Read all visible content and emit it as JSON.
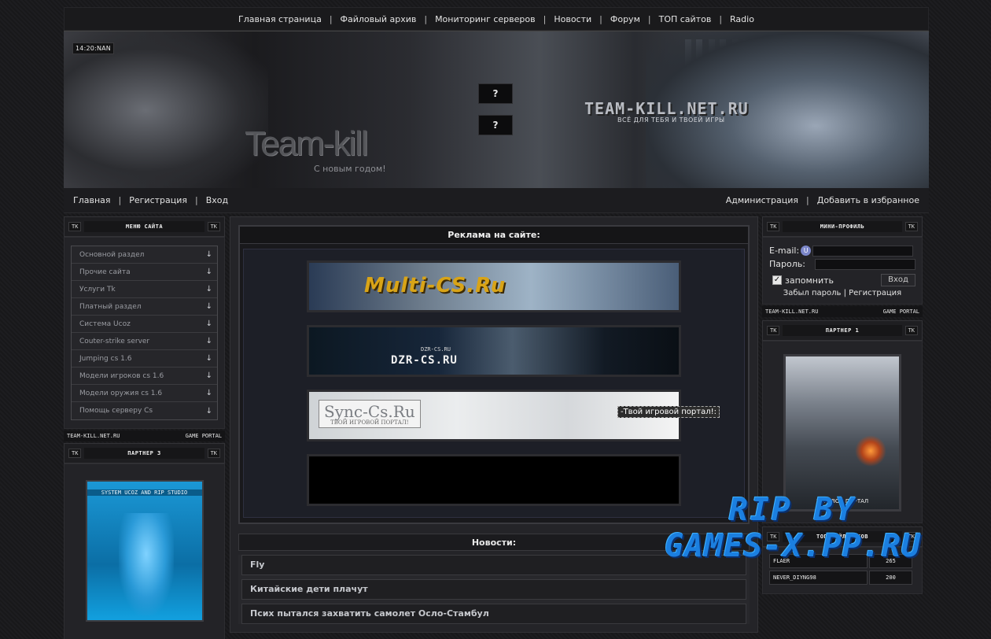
{
  "top_nav": [
    {
      "label": "Главная страница"
    },
    {
      "label": "Файловый архив"
    },
    {
      "label": "Мониторинг серверов"
    },
    {
      "label": "Новости"
    },
    {
      "label": "Форум"
    },
    {
      "label": "ТОП сайтов"
    },
    {
      "label": "Radio"
    }
  ],
  "banner": {
    "clock": "14:20:NAN",
    "buttons": [
      "?",
      "?"
    ],
    "logo": "Team-kill",
    "slogan": "С новым годом!",
    "site_title": "TEAM-KILL.NET.RU",
    "site_subtitle": "ВСЁ ДЛЯ ТЕБЯ И ТВОЕЙ ИГРЫ"
  },
  "sub_nav": {
    "left": [
      "Главная",
      "Регистрация",
      "Вход"
    ],
    "right": [
      "Администрация",
      "Добавить в избранное"
    ]
  },
  "tk": "TK",
  "left": {
    "menu_title": "Меню сайта",
    "menu_items": [
      "Основной раздел",
      "Прочие сайта",
      "Услуги Tk",
      "Платный раздел",
      "Система Ucoz",
      "Couter-strike server",
      "Jumping cs 1.6",
      "Модели игроков cs 1.6",
      "Модели оружия cs 1.6",
      "Помощь серверу Cs"
    ],
    "arrow": "↓",
    "strip_left": "TEAM-KILL.NET.RU",
    "strip_right": "GAME PORTAL",
    "partner_title": "Партнер 3",
    "partner_caption": "SYSTEM UCOZ AND RIP STUDIO"
  },
  "middle": {
    "ads_title": "Реклама на сайте:",
    "ad1": "Multi-CS.Ru",
    "ad2_small": "DZR-CS.RU",
    "ad2": "DZR-CS.RU",
    "ad3_logo": "Sync-Cs.Ru",
    "ad3_logo_sub": "ТВОЙ ИГРОВОЙ ПОРТАЛ!",
    "ad3_tag": "-Твой игровой портал!:",
    "news_title": "Новости:",
    "news": [
      "Fly",
      "Китайские дети плачут",
      "Псих пытался захватить самолет Осло-Стамбул"
    ]
  },
  "right": {
    "profile_title": "Мини-профиль",
    "email_label": "E-mail:",
    "password_label": "Пароль:",
    "remember": "запомнить",
    "login_button": "Вход",
    "forgot": "Забыл пароль",
    "register": "Регистрация",
    "links_sep": "|",
    "strip_left": "TEAM-KILL.NET.RU",
    "strip_right": "GAME PORTAL",
    "partner_title": "Партнер 1",
    "partner_caption": "ИГРОВОЙ ПОРТАЛ",
    "top_title": "Топ файловиков",
    "top_users": [
      {
        "name": "FLAER",
        "value": "265"
      },
      {
        "name": "NEVER_DIYNG98",
        "value": "200"
      }
    ]
  },
  "watermark": {
    "line1": "RIP BY",
    "line2": "GAMES-X.PP.RU"
  }
}
